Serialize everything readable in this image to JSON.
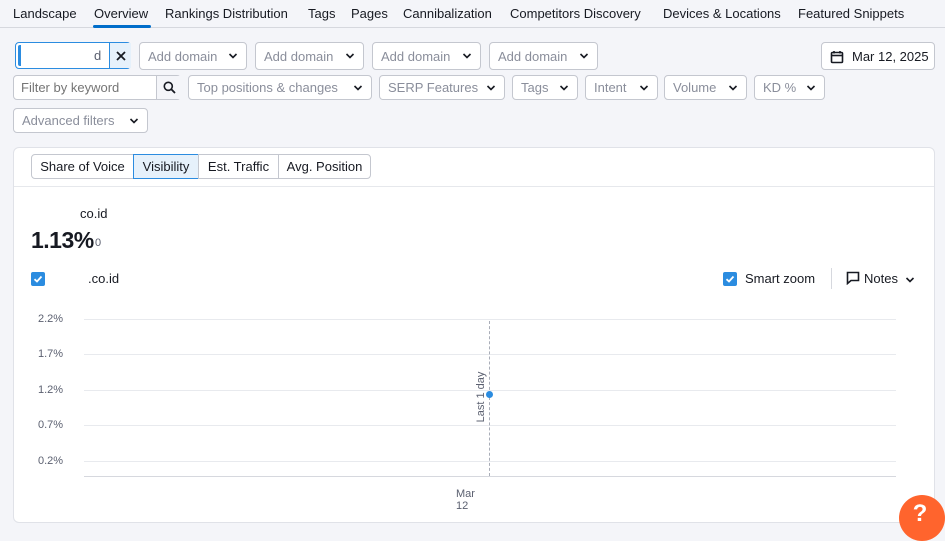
{
  "tabs": [
    "Landscape",
    "Overview",
    "Rankings Distribution",
    "Tags",
    "Pages",
    "Cannibalization",
    "Competitors Discovery",
    "Devices & Locations",
    "Featured Snippets"
  ],
  "domain_filter": {
    "value_suffix": "d"
  },
  "add_domain": [
    "Add domain",
    "Add domain",
    "Add domain",
    "Add domain"
  ],
  "date": "Mar 12, 2025",
  "keyword_filter": {
    "placeholder": "Filter by keyword"
  },
  "filters": [
    "Top positions & changes",
    "SERP Features",
    "Tags",
    "Intent",
    "Volume",
    "KD %"
  ],
  "advanced_filters": "Advanced filters",
  "metric_tabs": [
    "Share of Voice",
    "Visibility",
    "Est. Traffic",
    "Avg. Position"
  ],
  "active_metric": "Visibility",
  "summary": {
    "domain_suffix": "co.id",
    "value": "1.13%",
    "change": "0"
  },
  "legend": {
    "domain_suffix": ".co.id",
    "smart_zoom": "Smart zoom",
    "notes": "Notes"
  },
  "chart_data": {
    "type": "line",
    "x": [
      "Mar 12"
    ],
    "series": [
      {
        "values": [
          1.13
        ]
      }
    ],
    "yticks": [
      "2.2%",
      "1.7%",
      "1.2%",
      "0.7%",
      "0.2%"
    ],
    "ylim": [
      0.2,
      2.2
    ],
    "annotation": "Last 1 day",
    "colors": {
      "series": "#2b8ce0"
    }
  },
  "help_label": "?"
}
